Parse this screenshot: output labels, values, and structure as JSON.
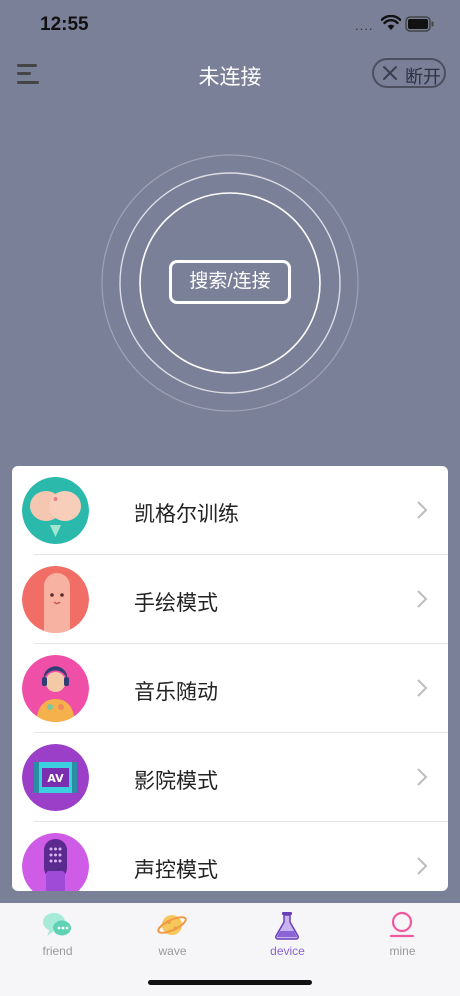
{
  "status_bar": {
    "time": "12:55",
    "signal": "....",
    "icons": [
      "wifi-icon",
      "battery-icon"
    ]
  },
  "header": {
    "title": "未连接",
    "disconnect_label": "断开",
    "menu_icon": "menu-icon",
    "close_icon": "close-icon"
  },
  "connect": {
    "button_label": "搜索/连接"
  },
  "modes": [
    {
      "label": "凯格尔训练",
      "icon": "kegel-icon"
    },
    {
      "label": "手绘模式",
      "icon": "finger-icon"
    },
    {
      "label": "音乐随动",
      "icon": "music-girl-icon"
    },
    {
      "label": "影院模式",
      "icon": "cinema-av-icon"
    },
    {
      "label": "声控模式",
      "icon": "microphone-icon"
    }
  ],
  "tabs": [
    {
      "label": "friend",
      "icon": "chat-bubbles-icon",
      "active": false
    },
    {
      "label": "wave",
      "icon": "planet-icon",
      "active": false
    },
    {
      "label": "device",
      "icon": "flask-icon",
      "active": true
    },
    {
      "label": "mine",
      "icon": "profile-icon",
      "active": false
    }
  ],
  "colors": {
    "background": "#7b8099",
    "accent": "#8b63d6",
    "card": "#ffffff"
  }
}
